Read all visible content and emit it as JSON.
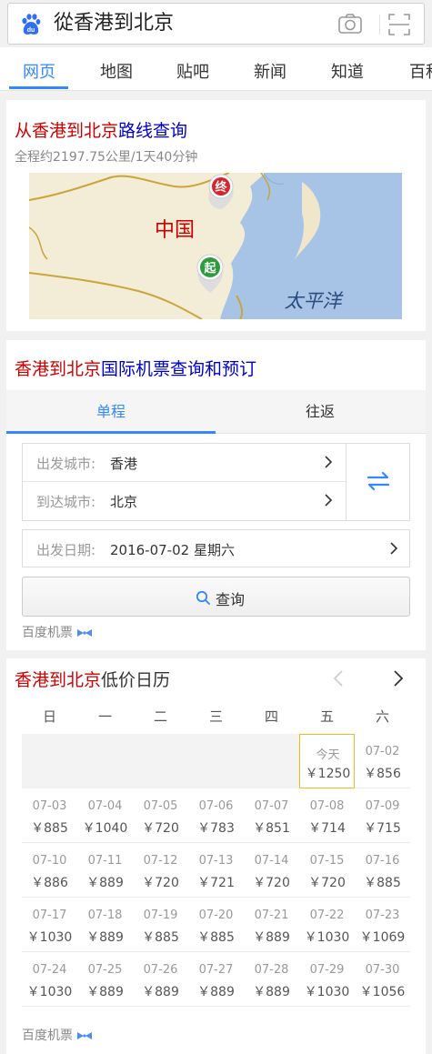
{
  "search": {
    "query": "從香港到北京"
  },
  "tabs": [
    "网页",
    "地图",
    "贴吧",
    "新闻",
    "知道",
    "百科"
  ],
  "route": {
    "title_red": "从香港到北京",
    "title_blue": "路线查询",
    "summary": "全程约2197.75公里/1天40分钟",
    "map": {
      "country_label": "中国",
      "ocean_label": "太平洋",
      "start_marker": "起",
      "end_marker": "终"
    }
  },
  "flights": {
    "title_red": "香港到北京",
    "title_blue": "国际机票查询和预订",
    "trip_types": [
      "单程",
      "往返"
    ],
    "depart_label": "出发城市:",
    "depart_value": "香港",
    "arrive_label": "到达城市:",
    "arrive_value": "北京",
    "date_label": "出发日期:",
    "date_value": "2016-07-02 星期六",
    "query_label": "查询",
    "brand": "百度机票"
  },
  "calendar": {
    "title_red": "香港到北京",
    "title_dark": "低价日历",
    "weekdays": [
      "日",
      "一",
      "二",
      "三",
      "四",
      "五",
      "六"
    ],
    "rows": [
      [
        null,
        null,
        null,
        null,
        null,
        {
          "d": "今天",
          "p": "￥1250",
          "today": true
        },
        {
          "d": "07-02",
          "p": "￥856"
        }
      ],
      [
        {
          "d": "07-03",
          "p": "￥885"
        },
        {
          "d": "07-04",
          "p": "￥1040"
        },
        {
          "d": "07-05",
          "p": "￥720"
        },
        {
          "d": "07-06",
          "p": "￥783"
        },
        {
          "d": "07-07",
          "p": "￥851"
        },
        {
          "d": "07-08",
          "p": "￥714"
        },
        {
          "d": "07-09",
          "p": "￥715"
        }
      ],
      [
        {
          "d": "07-10",
          "p": "￥886"
        },
        {
          "d": "07-11",
          "p": "￥889"
        },
        {
          "d": "07-12",
          "p": "￥720"
        },
        {
          "d": "07-13",
          "p": "￥721"
        },
        {
          "d": "07-14",
          "p": "￥720"
        },
        {
          "d": "07-15",
          "p": "￥720"
        },
        {
          "d": "07-16",
          "p": "￥885"
        }
      ],
      [
        {
          "d": "07-17",
          "p": "￥1030"
        },
        {
          "d": "07-18",
          "p": "￥889"
        },
        {
          "d": "07-19",
          "p": "￥885"
        },
        {
          "d": "07-20",
          "p": "￥885"
        },
        {
          "d": "07-21",
          "p": "￥889"
        },
        {
          "d": "07-22",
          "p": "￥1030"
        },
        {
          "d": "07-23",
          "p": "￥1069"
        }
      ],
      [
        {
          "d": "07-24",
          "p": "￥1030"
        },
        {
          "d": "07-25",
          "p": "￥889"
        },
        {
          "d": "07-26",
          "p": "￥889"
        },
        {
          "d": "07-27",
          "p": "￥889"
        },
        {
          "d": "07-28",
          "p": "￥889"
        },
        {
          "d": "07-29",
          "p": "￥1030"
        },
        {
          "d": "07-30",
          "p": "￥1056"
        }
      ]
    ],
    "brand": "百度机票"
  },
  "colors": {
    "accent": "#3388ff",
    "red": "#cc0000",
    "blue": "#0000cc",
    "today_border": "#f5b81c"
  },
  "icons": [
    "baidu-paw-icon",
    "camera-icon",
    "scan-icon",
    "chevron-right-icon",
    "swap-icon",
    "search-icon",
    "bowtie-icon",
    "chevron-left-icon"
  ]
}
